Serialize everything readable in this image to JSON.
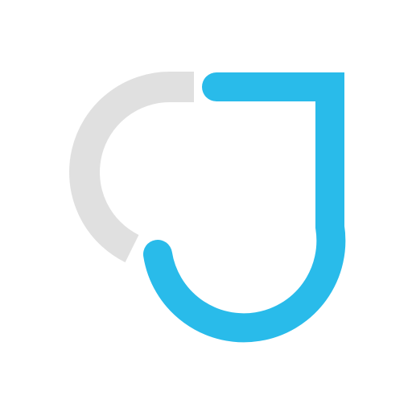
{
  "logo": {
    "icon": "cj-monogram-icon",
    "colors": {
      "c_stroke": "#e0e0e0",
      "j_stroke": "#29bbea",
      "background": "#ffffff"
    }
  }
}
